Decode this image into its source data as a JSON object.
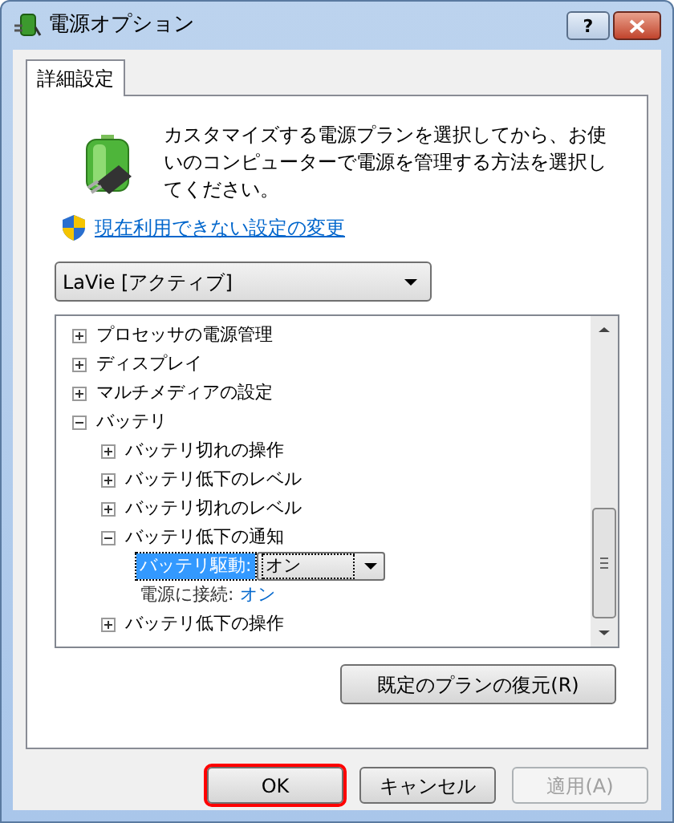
{
  "window": {
    "title": "電源オプション",
    "help_button": "?"
  },
  "tabs": [
    {
      "label": "詳細設定",
      "selected": true
    }
  ],
  "description": "カスタマイズする電源プランを選択してから、お使いのコンピューターで電源を管理する方法を選択してください。",
  "settings_link": "現在利用できない設定の変更",
  "plan_select": {
    "value": "LaVie [アクティブ]"
  },
  "tree": [
    {
      "label": "プロセッサの電源管理",
      "expanded": false
    },
    {
      "label": "ディスプレイ",
      "expanded": false
    },
    {
      "label": "マルチメディアの設定",
      "expanded": false
    },
    {
      "label": "バッテリ",
      "expanded": true,
      "children": [
        {
          "label": "バッテリ切れの操作",
          "expanded": false
        },
        {
          "label": "バッテリ低下のレベル",
          "expanded": false
        },
        {
          "label": "バッテリ切れのレベル",
          "expanded": false
        },
        {
          "label": "バッテリ低下の通知",
          "expanded": true,
          "children": [
            {
              "kind": "setting",
              "label": "バッテリ駆動:",
              "value": "オン",
              "selected": true
            },
            {
              "kind": "setting",
              "label": "電源に接続:",
              "value": "オン",
              "selected": false
            }
          ]
        },
        {
          "label": "バッテリ低下の操作",
          "expanded": false
        }
      ]
    }
  ],
  "restore_button": "既定のプランの復元(R)",
  "buttons": [
    {
      "label": "OK",
      "highlighted": true,
      "disabled": false
    },
    {
      "label": "キャンセル",
      "highlighted": false,
      "disabled": false
    },
    {
      "label": "適用(A)",
      "highlighted": false,
      "disabled": true
    }
  ]
}
